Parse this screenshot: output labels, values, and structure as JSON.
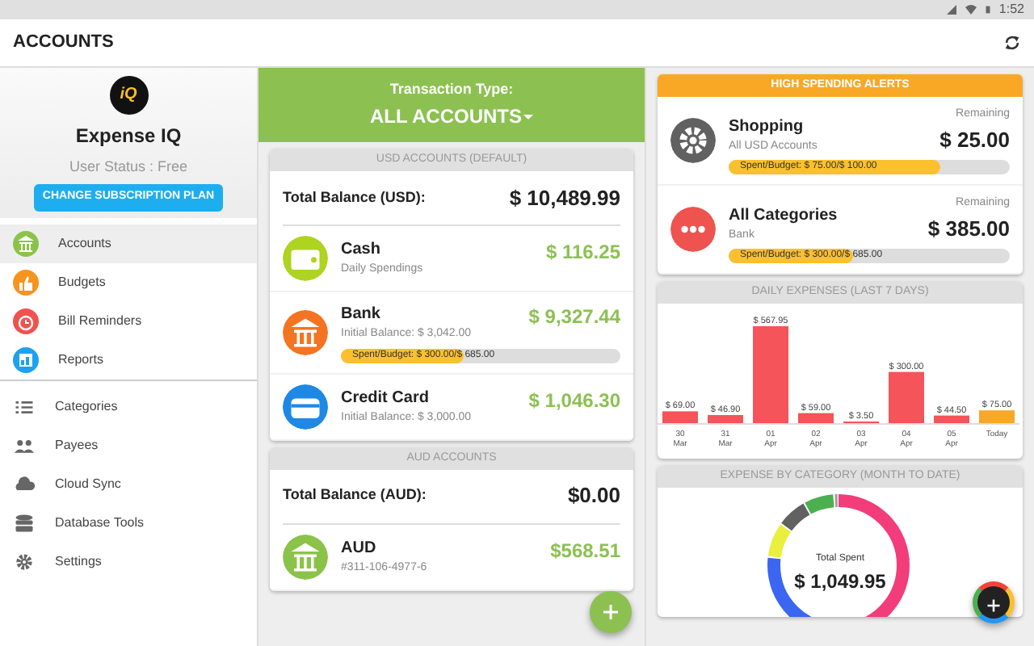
{
  "status_bar": {
    "time": "1:52"
  },
  "app_bar": {
    "title": "ACCOUNTS"
  },
  "sidebar": {
    "logo_text": "iQ",
    "app_name": "Expense IQ",
    "user_status": "User Status : Free",
    "upgrade_button": "CHANGE SUBSCRIPTION PLAN",
    "sections": [
      {
        "items": [
          {
            "label": "Accounts",
            "selected": true,
            "color": "#8bc34a"
          },
          {
            "label": "Budgets",
            "selected": false,
            "color": "#f7941d"
          },
          {
            "label": "Bill Reminders",
            "selected": false,
            "color": "#ef5350"
          },
          {
            "label": "Reports",
            "selected": false,
            "color": "#1da1f2"
          }
        ]
      },
      {
        "items": [
          {
            "label": "Categories",
            "selected": false
          },
          {
            "label": "Payees",
            "selected": false
          },
          {
            "label": "Cloud Sync",
            "selected": false
          },
          {
            "label": "Database Tools",
            "selected": false
          },
          {
            "label": "Settings",
            "selected": false
          }
        ]
      }
    ]
  },
  "transaction_type": {
    "label": "Transaction Type:",
    "value": "ALL ACCOUNTS"
  },
  "account_groups": [
    {
      "header": "USD ACCOUNTS (DEFAULT)",
      "total_label": "Total Balance (USD):",
      "total": "$ 10,489.99",
      "accounts": [
        {
          "kind": "cash",
          "color": "#aed321",
          "name": "Cash",
          "detail": "Daily Spendings",
          "amount": "$ 116.25"
        },
        {
          "kind": "bank",
          "color": "#f47421",
          "name": "Bank",
          "detail": "Initial Balance: $ 3,042.00",
          "amount": "$ 9,327.44",
          "budget": {
            "text": "Spent/Budget: $ 300.00/$ 685.00",
            "level": 0.44
          }
        },
        {
          "kind": "card",
          "color": "#1e88e5",
          "name": "Credit Card",
          "detail": "Initial Balance: $ 3,000.00",
          "amount": "$ 1,046.30"
        }
      ]
    },
    {
      "header": "AUD ACCOUNTS",
      "total_label": "Total Balance (AUD):",
      "total": "$0.00",
      "accounts": [
        {
          "kind": "bank",
          "color": "#8bc34a",
          "name": "AUD",
          "detail": "#311-106-4977-6",
          "amount": "$568.51"
        }
      ]
    }
  ],
  "alerts": {
    "header": "HIGH SPENDING ALERTS",
    "items": [
      {
        "kind": "shopping",
        "color": "#616161",
        "name": "Shopping",
        "detail": "All USD Accounts",
        "remaining_label": "Remaining",
        "remaining": "$ 25.00",
        "budget": {
          "text": "Spent/Budget: $ 75.00/$ 100.00",
          "level": 0.75
        }
      },
      {
        "kind": "other",
        "color": "#ef5350",
        "name": "All Categories",
        "detail": "Bank",
        "remaining_label": "Remaining",
        "remaining": "$ 385.00",
        "budget": {
          "text": "Spent/Budget: $ 300.00/$ 685.00",
          "level": 0.44
        }
      }
    ]
  },
  "daily_expenses": {
    "header": "DAILY EXPENSES (LAST 7 DAYS)",
    "chart_data": {
      "type": "bar",
      "categories": [
        "30 Mar",
        "31 Mar",
        "01 Apr",
        "02 Apr",
        "03 Apr",
        "04 Apr",
        "05 Apr",
        "Today"
      ],
      "values": [
        69.0,
        46.9,
        567.95,
        59.0,
        3.5,
        300.0,
        44.5,
        75.0
      ],
      "colors": [
        "#f4545a",
        "#f4545a",
        "#f4545a",
        "#f4545a",
        "#f4545a",
        "#f4545a",
        "#f4545a",
        "#f9a825"
      ],
      "value_labels": [
        "$ 69.00",
        "$ 46.90",
        "$ 567.95",
        "$ 59.00",
        "$ 3.50",
        "$ 300.00",
        "$ 44.50",
        "$ 75.00"
      ]
    }
  },
  "category_expenses": {
    "header": "EXPENSE BY CATEGORY (MONTH TO DATE)",
    "center_label": "Total Spent",
    "total": "$ 1,049.95"
  }
}
